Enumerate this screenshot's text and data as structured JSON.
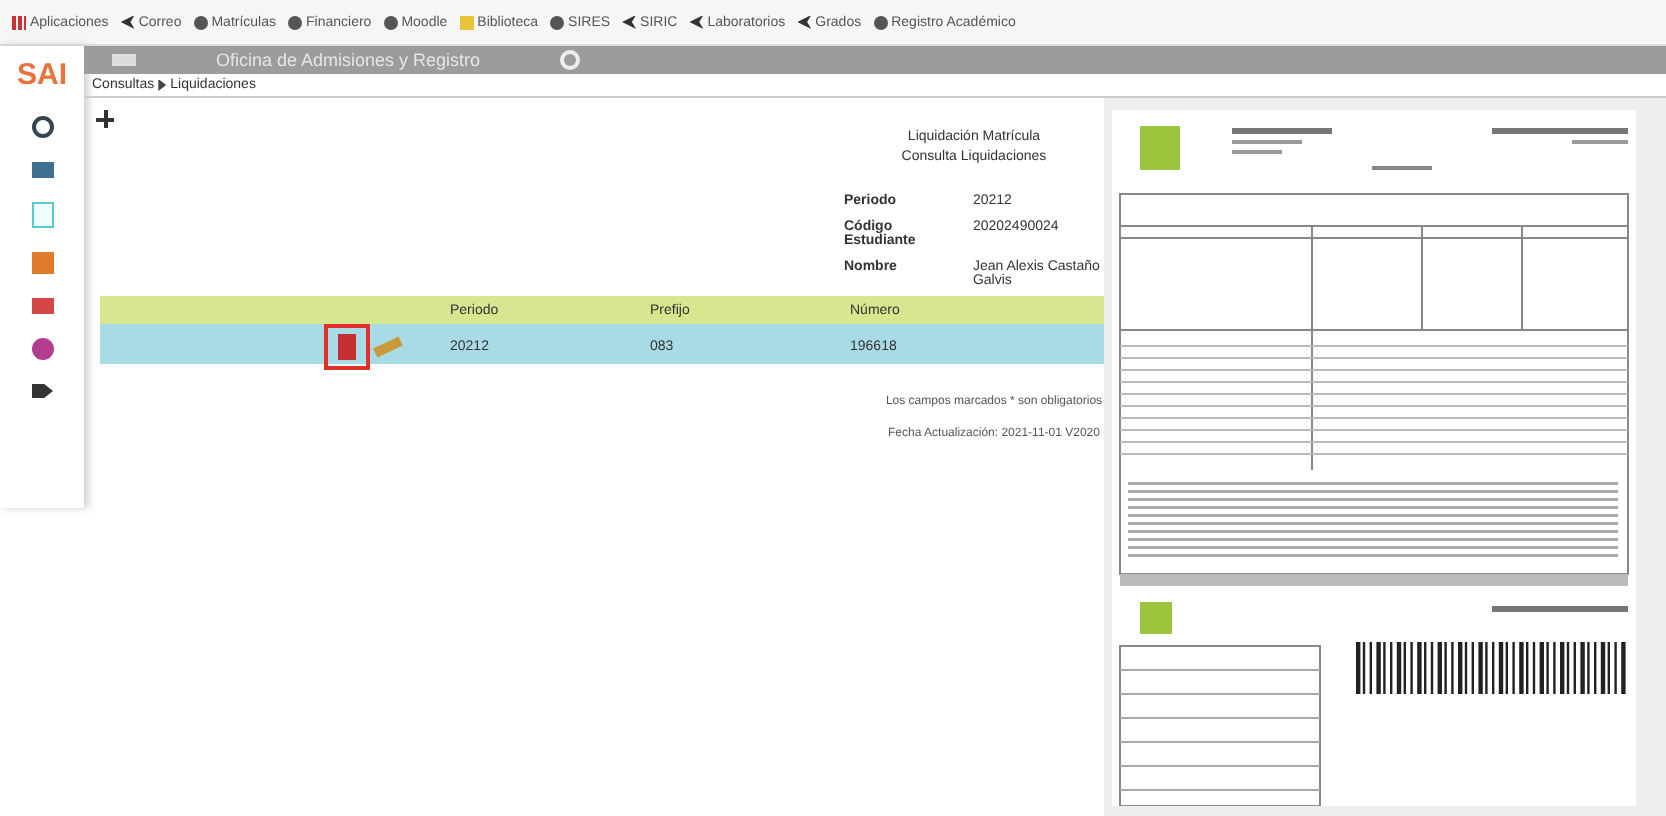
{
  "bookmarks": [
    {
      "label": "Aplicaciones",
      "kind": "apps"
    },
    {
      "label": "Correo",
      "kind": "share"
    },
    {
      "label": "Matrículas",
      "kind": "circle"
    },
    {
      "label": "Financiero",
      "kind": "circle"
    },
    {
      "label": "Moodle",
      "kind": "circle"
    },
    {
      "label": "Biblioteca",
      "kind": "book"
    },
    {
      "label": "SIRES",
      "kind": "circle"
    },
    {
      "label": "SIRIC",
      "kind": "share"
    },
    {
      "label": "Laboratorios",
      "kind": "share"
    },
    {
      "label": "Grados",
      "kind": "share"
    },
    {
      "label": "Registro Académico",
      "kind": "circle"
    }
  ],
  "app": {
    "logo": "SAI",
    "title": "Oficina de Admisiones y Registro"
  },
  "breadcrumb": [
    "Consultas",
    "Liquidaciones"
  ],
  "form": {
    "title": "Liquidación Matrícula",
    "subtitle": "Consulta Liquidaciones",
    "fields": [
      {
        "label": "Periodo",
        "value": "20212"
      },
      {
        "label": "Código Estudiante",
        "value": "20202490024"
      },
      {
        "label": "Nombre",
        "value": "Jean Alexis Castaño Galvis"
      }
    ]
  },
  "table": {
    "columns": [
      "Periodo",
      "Prefijo",
      "Número"
    ],
    "rows": [
      {
        "cells": [
          "20212",
          "083",
          "196618"
        ],
        "highlighted": true
      }
    ]
  },
  "notes": [
    "Los campos marcados * son obligatorios",
    "Fecha Actualización: 2021-11-01 V2020"
  ]
}
